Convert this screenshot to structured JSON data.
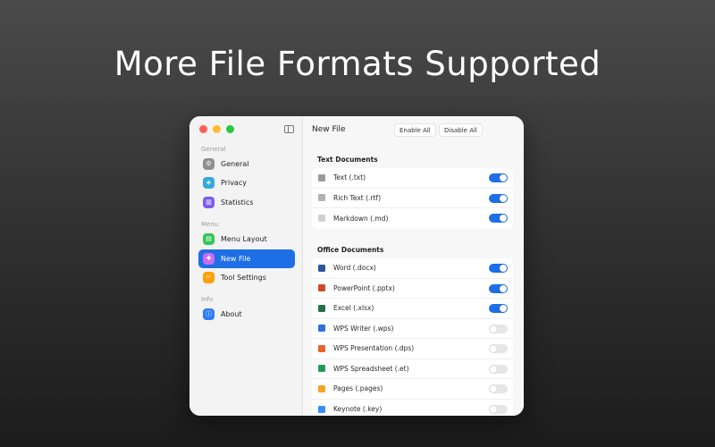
{
  "headline": "More File Formats Supported",
  "window": {
    "traffic_colors": [
      "#ff5f57",
      "#febc2e",
      "#28c840"
    ],
    "sidebar": {
      "sections": [
        {
          "label": "General",
          "items": [
            {
              "label": "General",
              "icon": "gear-icon",
              "color": "#8e8e93"
            },
            {
              "label": "Privacy",
              "icon": "shield-icon",
              "color": "#34aadc"
            },
            {
              "label": "Statistics",
              "icon": "chart-icon",
              "color": "#7d5cf0"
            }
          ]
        },
        {
          "label": "Menu",
          "items": [
            {
              "label": "Menu Layout",
              "icon": "layout-icon",
              "color": "#34c759"
            },
            {
              "label": "New File",
              "icon": "new-file-icon",
              "color": "#c86cf0",
              "active": true
            },
            {
              "label": "Tool Settings",
              "icon": "tools-icon",
              "color": "#ff9f0a"
            }
          ]
        },
        {
          "label": "Info",
          "items": [
            {
              "label": "About",
              "icon": "info-icon",
              "color": "#2f7cf6"
            }
          ]
        }
      ]
    },
    "main": {
      "title": "New File",
      "enable_all": "Enable All",
      "disable_all": "Disable All",
      "groups": [
        {
          "title": "Text Documents",
          "items": [
            {
              "label": "Text (.txt)",
              "icon": "text-file-icon",
              "color": "#9a9a9a",
              "enabled": true
            },
            {
              "label": "Rich Text (.rtf)",
              "icon": "rtf-file-icon",
              "color": "#b0b0b0",
              "enabled": true
            },
            {
              "label": "Markdown (.md)",
              "icon": "markdown-file-icon",
              "color": "#d0d0d0",
              "enabled": true
            }
          ]
        },
        {
          "title": "Office Documents",
          "items": [
            {
              "label": "Word (.docx)",
              "icon": "word-icon",
              "color": "#2b579a",
              "enabled": true
            },
            {
              "label": "PowerPoint (.pptx)",
              "icon": "powerpoint-icon",
              "color": "#d24726",
              "enabled": true
            },
            {
              "label": "Excel (.xlsx)",
              "icon": "excel-icon",
              "color": "#217346",
              "enabled": true
            },
            {
              "label": "WPS Writer (.wps)",
              "icon": "wps-writer-icon",
              "color": "#2f6fe0",
              "enabled": false
            },
            {
              "label": "WPS Presentation (.dps)",
              "icon": "wps-presentation-icon",
              "color": "#e8622c",
              "enabled": false
            },
            {
              "label": "WPS Spreadsheet (.et)",
              "icon": "wps-spreadsheet-icon",
              "color": "#1f9d55",
              "enabled": false
            },
            {
              "label": "Pages (.pages)",
              "icon": "pages-icon",
              "color": "#f5a623",
              "enabled": false
            },
            {
              "label": "Keynote (.key)",
              "icon": "keynote-icon",
              "color": "#3a8ef6",
              "enabled": false
            }
          ]
        }
      ]
    }
  }
}
